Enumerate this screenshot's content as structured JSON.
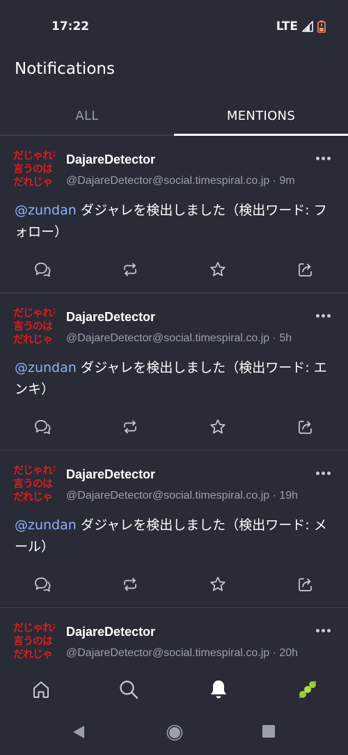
{
  "status_bar": {
    "time": "17:22",
    "network": "LTE"
  },
  "header": {
    "title": "Notifications"
  },
  "tabs": [
    {
      "label": "ALL",
      "active": false
    },
    {
      "label": "MENTIONS",
      "active": true
    }
  ],
  "avatar": {
    "lines": [
      "だじゃれを",
      "言うのは",
      "だれじゃ"
    ]
  },
  "posts": [
    {
      "display_name": "DajareDetector",
      "acct": "@DajareDetector@social.timespiral.co.jp",
      "time": "9m",
      "mention": "@zundan",
      "text": " ダジャレを検出しました（検出ワード: フォロー）"
    },
    {
      "display_name": "DajareDetector",
      "acct": "@DajareDetector@social.timespiral.co.jp",
      "time": "5h",
      "mention": "@zundan",
      "text": " ダジャレを検出しました（検出ワード: エンキ）"
    },
    {
      "display_name": "DajareDetector",
      "acct": "@DajareDetector@social.timespiral.co.jp",
      "time": "19h",
      "mention": "@zundan",
      "text": " ダジャレを検出しました（検出ワード: メール）"
    },
    {
      "display_name": "DajareDetector",
      "acct": "@DajareDetector@social.timespiral.co.jp",
      "time": "20h",
      "mention": "",
      "text": ""
    }
  ],
  "separator": " · ",
  "icons": {
    "reply": "reply-icon",
    "boost": "boost-icon",
    "favourite": "star-icon",
    "share": "share-icon",
    "home": "home-icon",
    "search": "search-icon",
    "notifications": "bell-icon",
    "profile": "profile-icon"
  },
  "colors": {
    "background": "#292b36",
    "accent_mention": "#8cb4ff",
    "avatar_red": "#d81e1e",
    "divider": "#3d4150"
  }
}
